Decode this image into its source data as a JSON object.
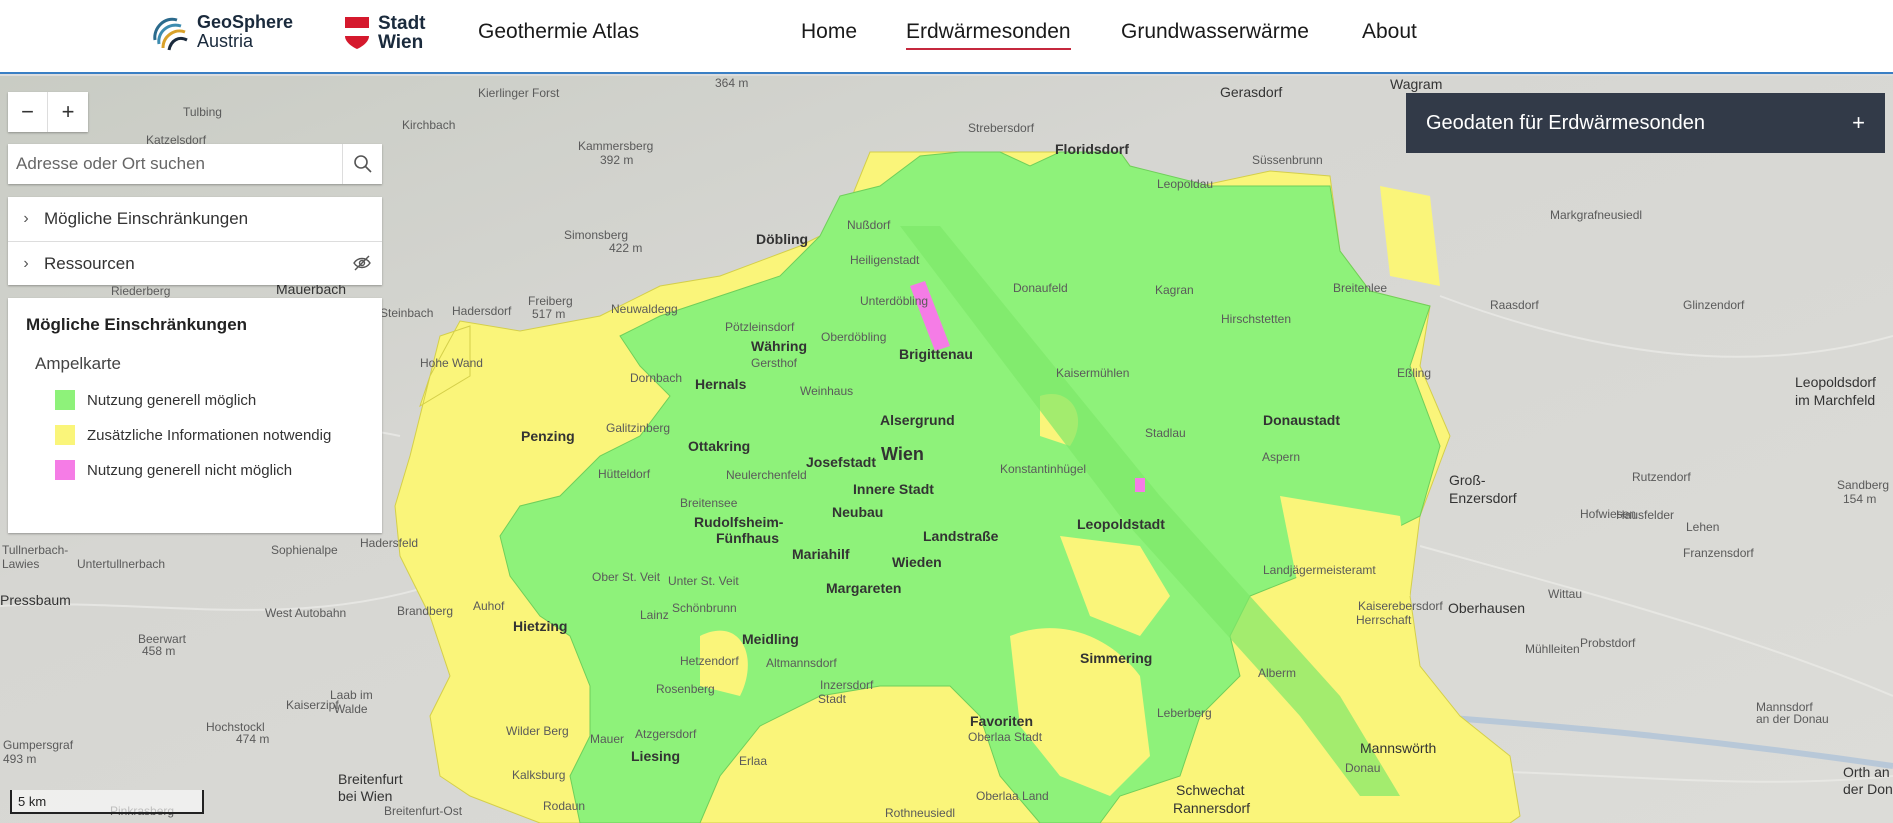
{
  "header": {
    "geosphere_line1": "GeoSphere",
    "geosphere_line2": "Austria",
    "wien_line1": "Stadt",
    "wien_line2": "Wien",
    "app_title": "Geothermie Atlas",
    "nav": [
      {
        "label": "Home",
        "active": false
      },
      {
        "label": "Erdwärmesonden",
        "active": true
      },
      {
        "label": "Grundwasserwärme",
        "active": false
      },
      {
        "label": "About",
        "active": false
      }
    ]
  },
  "controls": {
    "zoom_out": "−",
    "zoom_in": "+",
    "search_placeholder": "Adresse oder Ort suchen"
  },
  "layers": [
    {
      "label": "Mögliche Einschränkungen",
      "chevron": "›"
    },
    {
      "label": "Ressourcen",
      "chevron": "›",
      "icon": "eye-hidden-icon"
    }
  ],
  "legend": {
    "title": "Mögliche Einschränkungen",
    "subtitle": "Ampelkarte",
    "items": [
      {
        "label": "Nutzung generell möglich",
        "color": "#8ef27a"
      },
      {
        "label": "Zusätzliche Informationen notwendig",
        "color": "#faf57a"
      },
      {
        "label": "Nutzung generell nicht möglich",
        "color": "#f57ce6"
      }
    ]
  },
  "geodaten_panel": {
    "label": "Geodaten für Erdwärmesonden",
    "expand": "+"
  },
  "scale": {
    "label": "5 km"
  },
  "map": {
    "zone_colors": {
      "green": "#8ef27a",
      "yellow": "#faf57a",
      "magenta": "#f57ce6"
    },
    "places": [
      "Kierlinger Forst",
      "Tulbing",
      "Katzelsdorf",
      "Kirchbach",
      "Kammersberg",
      "392 m",
      "364 m",
      "Gerasdorf",
      "Wagram",
      "Strebersdorf",
      "Floridsdorf",
      "Süssenbrunn",
      "Leopoldau",
      "Markgrafneusiedl",
      "Simonsberg",
      "422 m",
      "Döbling",
      "Nußdorf",
      "Heiligenstadt",
      "Donaufeld",
      "Kagran",
      "Breitenlee",
      "Raasdorf",
      "Glinzendorf",
      "Riederberg",
      "Mauerbach",
      "Freiberg",
      "517 m",
      "Steinbach",
      "Hadersdorf",
      "Neuwaldegg",
      "Hirschstetten",
      "Unterdöbling",
      "Brigittenau",
      "Pötzleinsdorf",
      "Währing",
      "Gersthof",
      "Oberdöbling",
      "Kaisermühlen",
      "Eßling",
      "Hernals",
      "Dornbach",
      "Weinhaus",
      "Hohe Wand",
      "Leopoldsdorf",
      "im Marchfeld",
      "Penzing",
      "Galitzinberg",
      "Ottakring",
      "Alsergrund",
      "Stadlau",
      "Donaustadt",
      "Josefstadt",
      "Wien",
      "Hütteldorf",
      "Neulerchenfeld",
      "Konstantinhügel",
      "Aspern",
      "Groß-",
      "Enzersdorf",
      "Rutzendorf",
      "Sandberg",
      "154 m",
      "Innere Stadt",
      "Breitensee",
      "Neubau",
      "Hofwiesen",
      "Rudolfsheim-",
      "Fünfhaus",
      "Landstraße",
      "Leopoldstadt",
      "Lehen",
      "Tullnerbach-",
      "Lawies",
      "Untertullnerbach",
      "Sophienalpe",
      "Hadersfeld",
      "Mariahilf",
      "Wieden",
      "Franzensdorf",
      "Pressbaum",
      "Margareten",
      "Ober St. Veit",
      "Unter St. Veit",
      "Schönbrunn",
      "Landjägermeisteramt",
      "Oberhausen",
      "Wittau",
      "Beerwart",
      "458 m",
      "Lainz",
      "Auhof",
      "Brandberg",
      "Hietzing",
      "Meidling",
      "Kaiserebersdorf",
      "Herrschaft",
      "Mühlleiten",
      "Probstdorf",
      "Hetzendorf",
      "Altmannsdorf",
      "Simmering",
      "Alberm",
      "Rosenberg",
      "Inzersdorf",
      "Stadt",
      "Laab im",
      "Walde",
      "Hochstockl",
      "474 m",
      "Kaiserzipf",
      "Atzgersdorf",
      "Favoriten",
      "Oberlaa Stadt",
      "Mannsdorf",
      "an der Donau",
      "Gumpersgraf",
      "493 m",
      "Wilder Berg",
      "Mauer",
      "Liesing",
      "Erlaa",
      "Leberberg",
      "Mannswörth",
      "Orth an",
      "der Donau",
      "Breitenfurt",
      "bei Wien",
      "Kalksburg",
      "Rodaun",
      "Oberlaa Land",
      "Schwechat",
      "Rannersdorf",
      "Breitenfurt-Ost",
      "Rothneusiedl",
      "Hausfelder",
      "West Autobahn",
      "Donau",
      "Pinkrasberg"
    ]
  }
}
